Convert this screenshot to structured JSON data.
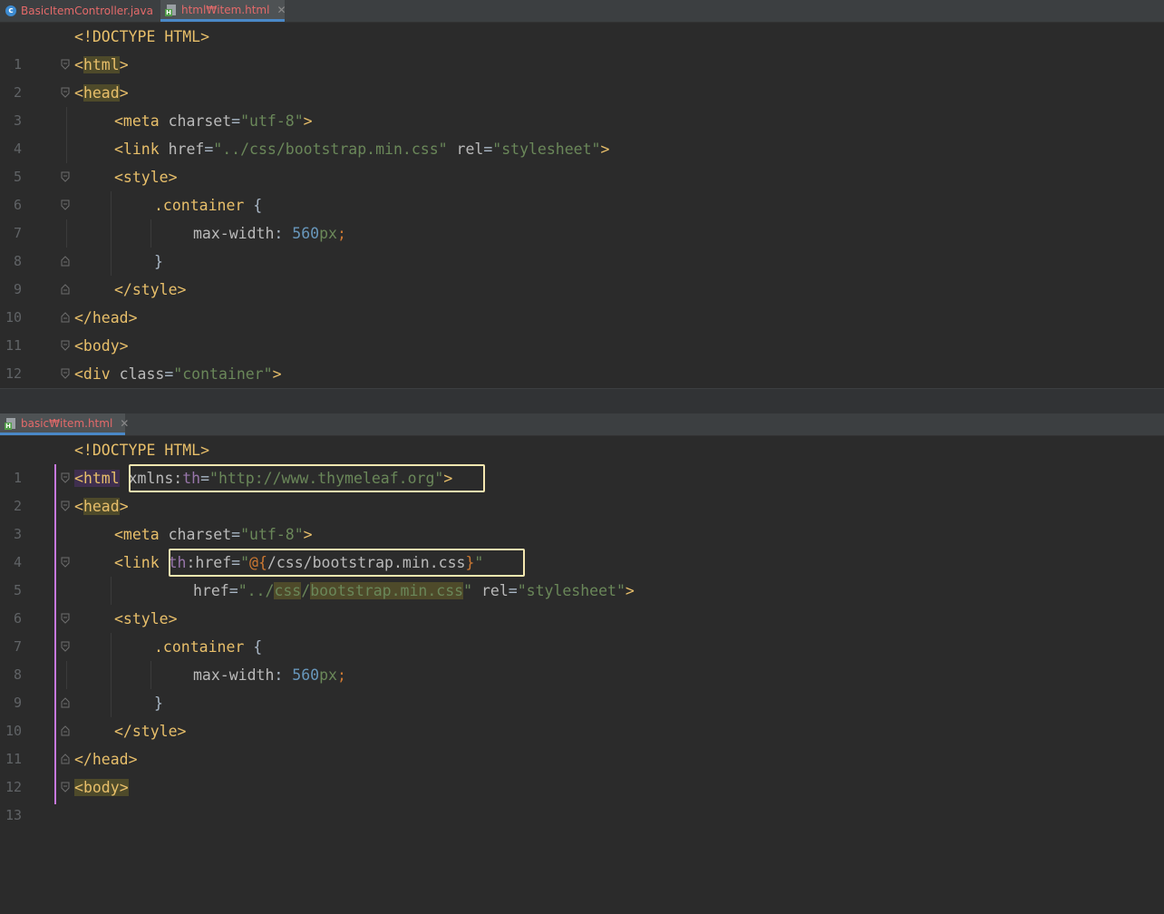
{
  "top": {
    "tabs": [
      {
        "label": "BasicItemController.java",
        "icon": "java-class-icon",
        "active": false
      },
      {
        "label": "html₩item.html",
        "icon": "html-file-icon",
        "active": true
      }
    ]
  },
  "bottom": {
    "tabs": [
      {
        "label": "basic₩item.html",
        "icon": "html-file-icon",
        "active": true
      }
    ]
  },
  "line_numbers": [
    "1",
    "2",
    "3",
    "4",
    "5",
    "6",
    "7",
    "8",
    "9",
    "10",
    "11",
    "12",
    "13"
  ],
  "top_code": {
    "l1": {
      "a": "<!DOCTYPE HTML>"
    },
    "l2": {
      "a": "<",
      "b": "html",
      "c": ">"
    },
    "l3": {
      "a": "<",
      "b": "head",
      "c": ">"
    },
    "l4": {
      "a": "<meta ",
      "b": "charset",
      "c": "=",
      "d": "\"utf-8\"",
      "e": ">"
    },
    "l5": {
      "a": "<link ",
      "b": "href",
      "c": "=",
      "d": "\"../css/bootstrap.min.css\"",
      "e": " rel",
      "f": "=",
      "g": "\"stylesheet\"",
      "h": ">"
    },
    "l6": {
      "a": "<style>"
    },
    "l7": {
      "a": ".container",
      "b": " {"
    },
    "l8": {
      "a": "max-width",
      "b": ": ",
      "c": "560",
      "d": "px",
      "e": ";"
    },
    "l9": {
      "a": "}"
    },
    "l10": {
      "a": "</style>"
    },
    "l11": {
      "a": "</",
      "b": "head",
      "c": ">"
    },
    "l12": {
      "a": "<body>"
    },
    "l13": {
      "a": "<div ",
      "b": "class",
      "c": "=",
      "d": "\"container\"",
      "e": ">"
    }
  },
  "bottom_code": {
    "l1": {
      "a": "<!DOCTYPE HTML>"
    },
    "l2": {
      "a": "<",
      "b": "html",
      "c": " ",
      "d": "xmlns:",
      "e": "th",
      "f": "=",
      "g": "\"http://www.thymeleaf.org\"",
      "h": ">"
    },
    "l3": {
      "a": "<",
      "b": "head",
      "c": ">"
    },
    "l4": {
      "a": "<meta ",
      "b": "charset",
      "c": "=",
      "d": "\"utf-8\"",
      "e": ">"
    },
    "l5": {
      "a": "<link ",
      "b": "th",
      "c": ":href",
      "d": "=",
      "e": "\"",
      "f": "@{",
      "g": "/css/bootstrap.min.css",
      "h": "}",
      "i": "\""
    },
    "l6": {
      "a": "href",
      "b": "=",
      "c": "\"../",
      "d": "css",
      "e": "/",
      "f": "bootstrap.min.css",
      "g": "\"",
      "h": " rel",
      "i": "=",
      "j": "\"stylesheet\"",
      "k": ">"
    },
    "l7": {
      "a": "<style>"
    },
    "l8": {
      "a": ".container",
      "b": " {"
    },
    "l9": {
      "a": "max-width",
      "b": ": ",
      "c": "560",
      "d": "px",
      "e": ";"
    },
    "l10": {
      "a": "}"
    },
    "l11": {
      "a": "</style>"
    },
    "l12": {
      "a": "</",
      "b": "head",
      "c": ">"
    },
    "l13": {
      "a": "<",
      "b": "body",
      "c": ">"
    }
  },
  "colors": {
    "background": "#2b2b2b",
    "tag": "#e8bf6a",
    "string": "#6a8759",
    "number": "#6897bb",
    "keyword": "#cc7832",
    "namespace": "#9876aa",
    "highlight_box": "#f4e7b0",
    "change_marker": "#c678dd"
  }
}
